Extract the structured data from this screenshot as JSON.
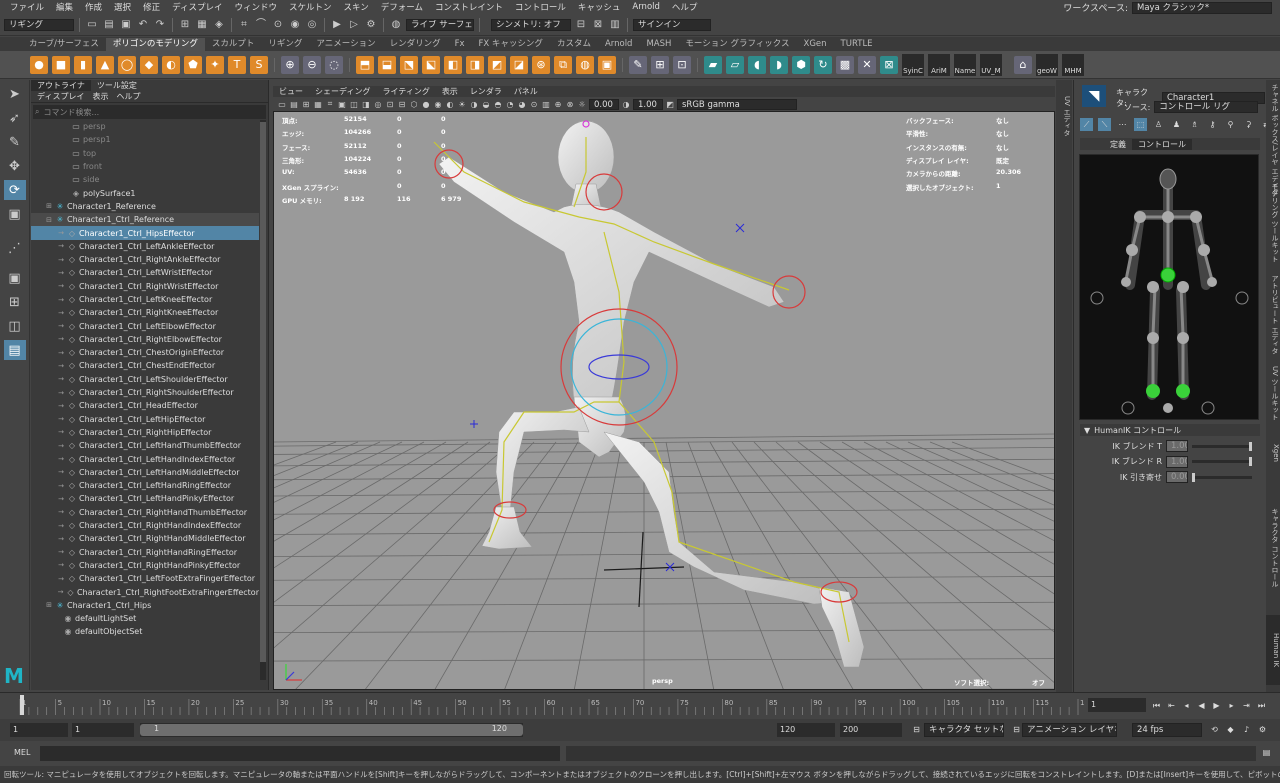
{
  "menubar": {
    "items": [
      "ファイル",
      "編集",
      "作成",
      "選択",
      "修正",
      "ディスプレイ",
      "ウィンドウ",
      "スケルトン",
      "スキン",
      "デフォーム",
      "コンストレイント",
      "コントロール",
      "キャッシュ",
      "Arnold",
      "ヘルプ"
    ],
    "workspace_label": "ワークスペース:",
    "workspace_value": "Maya クラシック*"
  },
  "statusline": {
    "menuset": "リギング",
    "live_surface": "ライブ サーフェスなし",
    "symmetry": "シンメトリ: オフ",
    "sign_in": "サインイン"
  },
  "shelf": {
    "tabs": [
      "カーブ/サーフェス",
      "ポリゴンのモデリング",
      "スカルプト",
      "リギング",
      "アニメーション",
      "レンダリング",
      "Fx",
      "FX キャッシング",
      "カスタム",
      "Arnold",
      "MASH",
      "モーション グラフィックス",
      "XGen",
      "TURTLE"
    ],
    "active_tab": "ポリゴンのモデリング",
    "text_icons": [
      "SyinC",
      "AriM",
      "Name",
      "UV_M",
      "geoW",
      "MHM"
    ]
  },
  "outliner": {
    "tabs": [
      "アウトライナ",
      "ツール設定"
    ],
    "menu": [
      "ディスプレイ",
      "表示",
      "ヘルプ"
    ],
    "search_placeholder": "コマンド検索...",
    "items": [
      {
        "label": "persp",
        "kind": "camera",
        "dim": true
      },
      {
        "label": "persp1",
        "kind": "camera",
        "dim": true
      },
      {
        "label": "top",
        "kind": "camera",
        "dim": true
      },
      {
        "label": "front",
        "kind": "camera",
        "dim": true
      },
      {
        "label": "side",
        "kind": "camera",
        "dim": true
      },
      {
        "label": "polySurface1",
        "kind": "mesh"
      },
      {
        "label": "Character1_Reference",
        "kind": "joint",
        "exp": "+"
      },
      {
        "label": "Character1_Ctrl_Reference",
        "kind": "joint",
        "exp": "-",
        "ref": true
      },
      {
        "label": "Character1_Ctrl_HipsEffector",
        "kind": "effector",
        "sel": true
      },
      {
        "label": "Character1_Ctrl_LeftAnkleEffector",
        "kind": "effector"
      },
      {
        "label": "Character1_Ctrl_RightAnkleEffector",
        "kind": "effector"
      },
      {
        "label": "Character1_Ctrl_LeftWristEffector",
        "kind": "effector"
      },
      {
        "label": "Character1_Ctrl_RightWristEffector",
        "kind": "effector"
      },
      {
        "label": "Character1_Ctrl_LeftKneeEffector",
        "kind": "effector"
      },
      {
        "label": "Character1_Ctrl_RightKneeEffector",
        "kind": "effector"
      },
      {
        "label": "Character1_Ctrl_LeftElbowEffector",
        "kind": "effector"
      },
      {
        "label": "Character1_Ctrl_RightElbowEffector",
        "kind": "effector"
      },
      {
        "label": "Character1_Ctrl_ChestOriginEffector",
        "kind": "effector"
      },
      {
        "label": "Character1_Ctrl_ChestEndEffector",
        "kind": "effector"
      },
      {
        "label": "Character1_Ctrl_LeftShoulderEffector",
        "kind": "effector"
      },
      {
        "label": "Character1_Ctrl_RightShoulderEffector",
        "kind": "effector"
      },
      {
        "label": "Character1_Ctrl_HeadEffector",
        "kind": "effector"
      },
      {
        "label": "Character1_Ctrl_LeftHipEffector",
        "kind": "effector"
      },
      {
        "label": "Character1_Ctrl_RightHipEffector",
        "kind": "effector"
      },
      {
        "label": "Character1_Ctrl_LeftHandThumbEffector",
        "kind": "effector"
      },
      {
        "label": "Character1_Ctrl_LeftHandIndexEffector",
        "kind": "effector"
      },
      {
        "label": "Character1_Ctrl_LeftHandMiddleEffector",
        "kind": "effector"
      },
      {
        "label": "Character1_Ctrl_LeftHandRingEffector",
        "kind": "effector"
      },
      {
        "label": "Character1_Ctrl_LeftHandPinkyEffector",
        "kind": "effector"
      },
      {
        "label": "Character1_Ctrl_RightHandThumbEffector",
        "kind": "effector"
      },
      {
        "label": "Character1_Ctrl_RightHandIndexEffector",
        "kind": "effector"
      },
      {
        "label": "Character1_Ctrl_RightHandMiddleEffector",
        "kind": "effector"
      },
      {
        "label": "Character1_Ctrl_RightHandRingEffector",
        "kind": "effector"
      },
      {
        "label": "Character1_Ctrl_RightHandPinkyEffector",
        "kind": "effector"
      },
      {
        "label": "Character1_Ctrl_LeftFootExtraFingerEffector",
        "kind": "effector"
      },
      {
        "label": "Character1_Ctrl_RightFootExtraFingerEffector",
        "kind": "effector"
      },
      {
        "label": "Character1_Ctrl_Hips",
        "kind": "joint",
        "exp": "+"
      },
      {
        "label": "defaultLightSet",
        "kind": "set",
        "top": true
      },
      {
        "label": "defaultObjectSet",
        "kind": "set",
        "top": true
      }
    ]
  },
  "viewport": {
    "menu": [
      "ビュー",
      "シェーディング",
      "ライティング",
      "表示",
      "レンダラ",
      "パネル"
    ],
    "exposure": "0.00",
    "gamma": "1.00",
    "color_space": "sRGB gamma",
    "camera_label": "persp",
    "soft_select_label": "ソフト選択:",
    "soft_select_value": "オフ",
    "hud_left": [
      {
        "label": "頂点:",
        "a": "52154",
        "b": "0",
        "c": "0"
      },
      {
        "label": "エッジ:",
        "a": "104266",
        "b": "0",
        "c": "0"
      },
      {
        "label": "フェース:",
        "a": "52112",
        "b": "0",
        "c": "0"
      },
      {
        "label": "三角形:",
        "a": "104224",
        "b": "0",
        "c": "0"
      },
      {
        "label": "UV:",
        "a": "54636",
        "b": "0",
        "c": "0"
      },
      {
        "label": "XGen スプライン:",
        "a": "",
        "b": "0",
        "c": "0"
      },
      {
        "label": "GPU メモリ:",
        "a": "8 192",
        "b": "116",
        "c": "6 979"
      }
    ],
    "hud_right": [
      {
        "label": "バックフェース:",
        "value": "なし"
      },
      {
        "label": "平滑性:",
        "value": "なし"
      },
      {
        "label": "インスタンスの有無:",
        "value": "なし"
      },
      {
        "label": "ディスプレイ レイヤ:",
        "value": "既定"
      },
      {
        "label": "カメラからの距離:",
        "value": "20.306"
      },
      {
        "label": "選択したオブジェクト:",
        "value": "1"
      }
    ]
  },
  "right_strip": {
    "label": "UV エディタ"
  },
  "side_tabs": [
    "チャネル ボックス/レイヤ エディタ",
    "モデリング ツールキット",
    "アトリビュート エディタ",
    "UV ツールキット",
    "Xgen",
    "キャラクタ コントロール",
    "Human IK"
  ],
  "hik": {
    "character_label": "キャラクタ:",
    "character_value": "Character1",
    "source_label": "ソース:",
    "source_value": "コントロール リグ",
    "tabs": [
      "定義",
      "コントロール"
    ],
    "active_tab": "コントロール",
    "section_title": "HumanIK コントロール",
    "sliders": [
      {
        "label": "IK ブレンド T",
        "value": "1.00"
      },
      {
        "label": "IK ブレンド R",
        "value": "1.00"
      },
      {
        "label": "IK 引き寄せ",
        "value": "0.00"
      }
    ]
  },
  "timeline": {
    "ticks": [
      "1",
      "5",
      "10",
      "15",
      "20",
      "25",
      "30",
      "35",
      "40",
      "45",
      "50",
      "55",
      "60",
      "65",
      "70",
      "75",
      "80",
      "85",
      "90",
      "95",
      "100",
      "105",
      "110",
      "115",
      "1"
    ],
    "current_frame": "1"
  },
  "range": {
    "start": "1",
    "playback_start": "1",
    "slider_start": "1",
    "slider_end": "120",
    "playback_end": "120",
    "end": "200",
    "character_set": "キャラクタ セットなし",
    "anim_layer": "アニメーション レイヤなし",
    "fps": "24 fps"
  },
  "cmdline": {
    "label": "MEL"
  },
  "helpline": {
    "text": "回転ツール: マニピュレータを使用してオブジェクトを回転します。マニピュレータの軸または平面ハンドルを[Shift]キーを押しながらドラッグして、コンポーネントまたはオブジェクトのクローンを押し出します。[Ctrl]+[Shift]+左マウス ボタンを押しながらドラッグして、接続されているエッジに回転をコンストレイントします。[D]または[Insert]キーを使用して、ピボットの位置および軸の方向を変更します。"
  },
  "colors": {
    "accent": "#5285a6",
    "shelf_orange": "#e08a2a",
    "rig_yellow": "#c8c832",
    "hik_green": "#3ad13a"
  }
}
